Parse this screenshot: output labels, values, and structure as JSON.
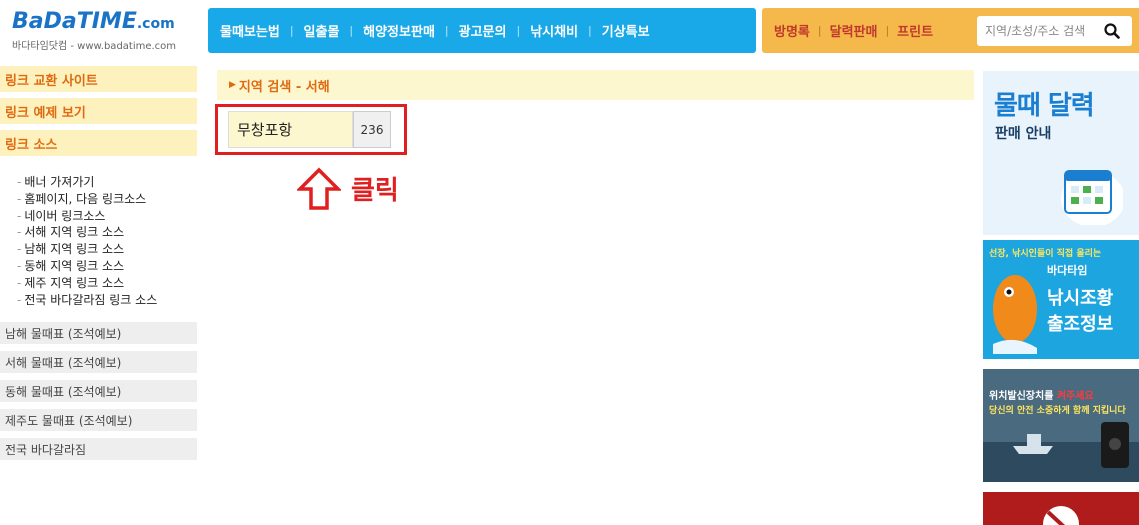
{
  "logo": {
    "part1": "BaDa",
    "part2": "TIME",
    "domain": ".com",
    "subtitle": "바다타임닷컴 - www.badatime.com"
  },
  "topnav": {
    "items": [
      "물때보는법",
      "일출몰",
      "해양정보판매",
      "광고문의",
      "낚시채비",
      "기상특보"
    ]
  },
  "topright": {
    "items": [
      "방명록",
      "달력판매",
      "프린트"
    ],
    "search_placeholder": "지역/초성/주소 검색"
  },
  "sidebar": {
    "headers": [
      "링크 교환 사이트",
      "링크 예제 보기",
      "링크 소스"
    ],
    "links": [
      "배너 가져가기",
      "홈페이지, 다음 링크소스",
      "네이버 링크소스",
      "서해 지역 링크 소스",
      "남해 지역 링크 소스",
      "동해 지역 링크 소스",
      "제주 지역 링크 소스",
      "전국 바다갈라짐 링크 소스"
    ],
    "tide_tables": [
      "남해 물때표 (조석예보)",
      "서해 물때표 (조석예보)",
      "동해 물때표 (조석예보)",
      "제주도 물때표 (조석예보)",
      "전국 바다갈라짐"
    ]
  },
  "main": {
    "region_title": "지역 검색 - 서해",
    "result": {
      "name": "무창포항",
      "count": "236"
    },
    "annotation": "클릭"
  },
  "ads": {
    "ad1": {
      "title": "물때 달력",
      "subtitle": "판매 안내"
    },
    "ad2": {
      "tagline": "선장, 낚시인들이 직접 올리는",
      "brand": "바다타임",
      "line1": "낚시조황",
      "line2": "출조정보"
    },
    "ad3": {
      "line1_a": "위치발신장치를 ",
      "line1_b": "켜주세요",
      "line2": "당신의 안전 소중하게 함께 지킵니다"
    }
  },
  "colors": {
    "nav_blue": "#1aa9e8",
    "nav_orange": "#f5b94b",
    "sidebar_head_bg": "#fdf2bd",
    "accent_orange": "#e06a10",
    "highlight_red": "#e02020"
  },
  "icons": {
    "search": "search-icon",
    "arrow": "arrow-up-icon"
  }
}
